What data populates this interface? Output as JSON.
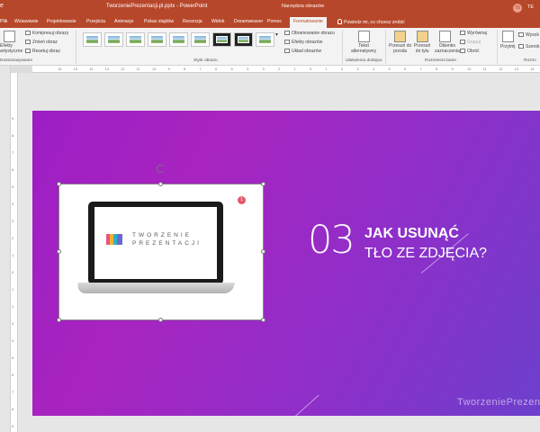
{
  "titlebar": {
    "file_title": "TworzeniePrezentacji.pl.pptx  -  PowerPoint",
    "context_group": "Narzędzia obrazów",
    "user_initials": "TE",
    "account_partial": "TE"
  },
  "tabs": [
    {
      "label": "Plik"
    },
    {
      "label": "Wstawianie"
    },
    {
      "label": "Projektowanie"
    },
    {
      "label": "Przejścia"
    },
    {
      "label": "Animacje"
    },
    {
      "label": "Pokaz slajdów"
    },
    {
      "label": "Recenzja"
    },
    {
      "label": "Widok"
    },
    {
      "label": "Dreamweaver"
    },
    {
      "label": "Pomoc"
    },
    {
      "label": "Formatowanie"
    }
  ],
  "tell_me": "Powiedz mi, co chcesz zrobić",
  "ribbon": {
    "adjust": {
      "artistic_effects": "Efekty\nartystyczne",
      "compress": "Kompresuj obrazy",
      "change": "Zmień obraz",
      "reset": "Resetuj obraz",
      "group_label": "Dostosowywanie"
    },
    "styles": {
      "group_label": "Style obrazu",
      "border": "Obramowanie obrazu",
      "effects": "Efekty obrazów",
      "layout": "Układ obrazów"
    },
    "accessibility": {
      "alt_text": "Tekst\nalternatywny",
      "group_label": "Ułatwienia dostępu"
    },
    "arrange": {
      "bring_forward": "Przesuń do\nprzodu",
      "send_backward": "Przesuń\ndo tyłu",
      "selection_pane": "Okienko\nzaznaczenia",
      "align": "Wyrównaj",
      "group": "Grupuj",
      "rotate": "Obróć",
      "group_label": "Rozmieszczanie"
    },
    "size": {
      "crop": "Przytnij",
      "height": "Wysok",
      "width": "Szerok",
      "group_label": "Rozmi"
    }
  },
  "ruler_h": [
    "16",
    "15",
    "14",
    "13",
    "12",
    "11",
    "10",
    "9",
    "8",
    "7",
    "6",
    "5",
    "4",
    "3",
    "2",
    "1",
    "0",
    "1",
    "2",
    "3",
    "4",
    "5",
    "6",
    "7",
    "8",
    "9",
    "10",
    "11",
    "12",
    "13",
    "14",
    "15",
    "16"
  ],
  "ruler_v": [
    "9",
    "8",
    "7",
    "6",
    "5",
    "4",
    "3",
    "2",
    "1",
    "0",
    "1",
    "2",
    "3",
    "4",
    "5",
    "6",
    "7",
    "8",
    "9"
  ],
  "slide": {
    "number": "03",
    "heading_line1": "JAK USUNĄĆ",
    "heading_line2": "TŁO ZE ZDJĘCIA?",
    "brand": "TworzeniePrezen",
    "logo_line1": "TWORZENIE",
    "logo_line2": "PREZENTACJI",
    "badge": "1",
    "gradient_start": "#9c1ec4",
    "gradient_end": "#6c3fcc"
  }
}
